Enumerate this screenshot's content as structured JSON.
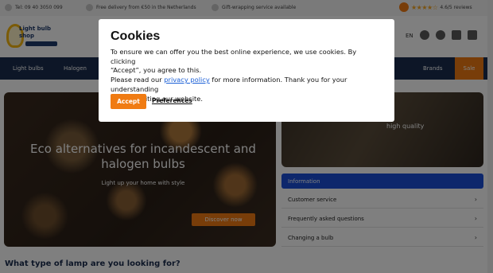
{
  "topbar": {
    "items": [
      "Tel: 09 40 3050 099",
      "Free delivery from €50 in the Netherlands",
      "Gift-wrapping service available"
    ],
    "rating_stars": "★★★★☆",
    "rating_text": "4.6/5 reviews"
  },
  "header": {
    "logo_text": "Light bulb shop",
    "language": "EN"
  },
  "nav": {
    "items": [
      "Light bulbs",
      "Halogen",
      "Brands"
    ],
    "cta": "Sale"
  },
  "hero": {
    "title": "Eco alternatives for incandescent and halogen bulbs",
    "subtitle": "Light up your home with style",
    "button": "Discover now"
  },
  "side": {
    "image_caption": "high quality",
    "active_item": "Information",
    "rows": [
      "Customer service",
      "Frequently asked questions",
      "Changing a bulb"
    ]
  },
  "section_question": "What type of lamp are you looking for?",
  "cookie": {
    "title": "Cookies",
    "line1": "To ensure we can offer you the best online experience, we use cookies. By clicking",
    "line2": "“Accept”, you agree to this.",
    "line3_before": "Please read our ",
    "privacy_link": "privacy policy",
    "line3_after": " for more information. Thank you for your understanding",
    "line4": "and for visiting our website.",
    "accept_label": "Accept",
    "preferences_label": "Preferences"
  },
  "colors": {
    "accent": "#f07b12",
    "nav_bg": "#1b2d4f",
    "link": "#1a5fd6",
    "active_panel": "#1a4fd8"
  }
}
